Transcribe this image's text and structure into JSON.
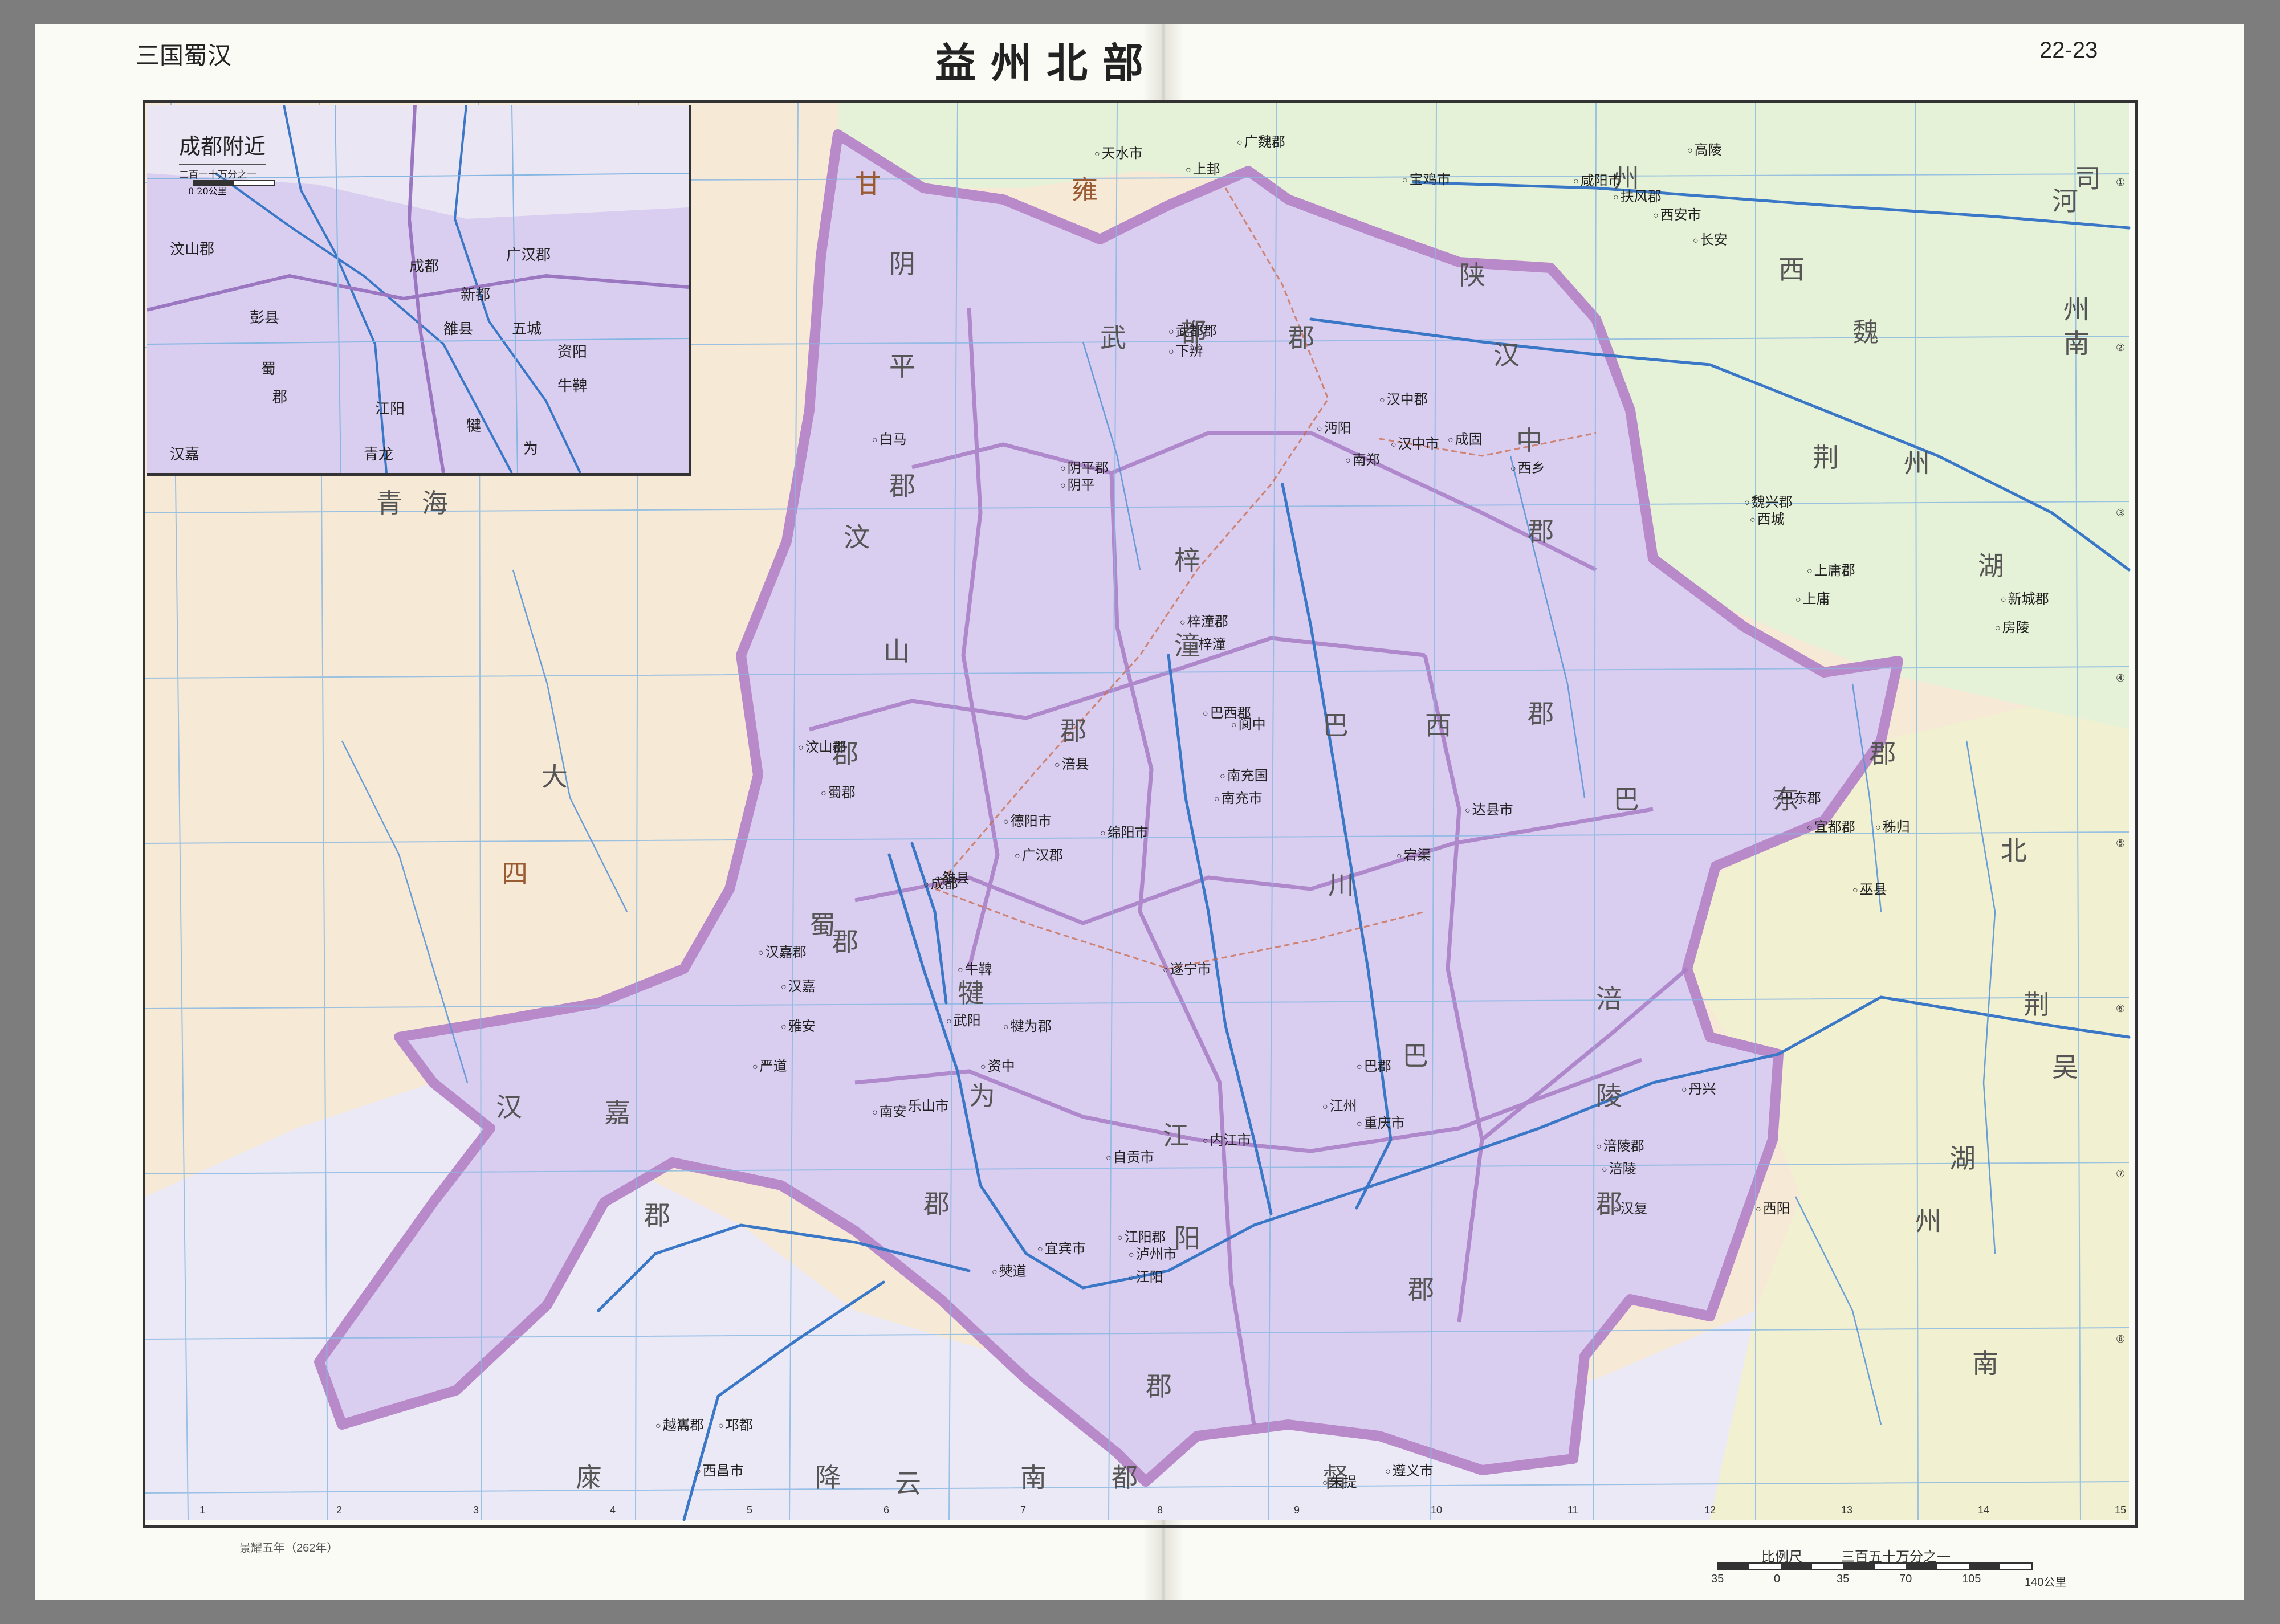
{
  "header": {
    "series_label": "三国蜀汉",
    "map_title": "益州北部",
    "page_numbers": "22-23"
  },
  "inset": {
    "title": "成都附近",
    "scale_text": "二百一十万分之一",
    "scale_ticks": [
      "0",
      "20公里"
    ],
    "labels": [
      "汶山郡",
      "蜀",
      "郡",
      "犍",
      "为",
      "成都",
      "广汉郡",
      "新都",
      "雒县",
      "五城",
      "江阳",
      "牛鞞",
      "资阳",
      "彭县",
      "汉嘉",
      "青龙"
    ]
  },
  "map": {
    "colors": {
      "shu_fill": "#d9cdf0",
      "shu_border": "#b98ac9",
      "wei_fill": "#e6f2d8",
      "qiang_fill": "#f6ead7",
      "south_fill": "#ece9f6",
      "river": "#3a78c7",
      "grid": "#86b7e3",
      "road": "#c96a4a"
    },
    "regions": [
      {
        "text": "甘",
        "style": "brown"
      },
      {
        "text": "阴",
        "style": "plain"
      },
      {
        "text": "平",
        "style": "plain"
      },
      {
        "text": "郡",
        "style": "plain"
      },
      {
        "text": "武",
        "style": "plain"
      },
      {
        "text": "都",
        "style": "plain"
      },
      {
        "text": "郡",
        "style": "plain"
      },
      {
        "text": "汶",
        "style": "plain"
      },
      {
        "text": "山",
        "style": "plain"
      },
      {
        "text": "郡",
        "style": "plain"
      },
      {
        "text": "梓",
        "style": "plain"
      },
      {
        "text": "潼",
        "style": "plain"
      },
      {
        "text": "郡",
        "style": "plain"
      },
      {
        "text": "巴",
        "style": "plain"
      },
      {
        "text": "西",
        "style": "plain"
      },
      {
        "text": "郡",
        "style": "plain"
      },
      {
        "text": "陕",
        "style": "plain"
      },
      {
        "text": "汉",
        "style": "plain"
      },
      {
        "text": "中",
        "style": "plain"
      },
      {
        "text": "郡",
        "style": "plain"
      },
      {
        "text": "巴",
        "style": "plain"
      },
      {
        "text": "东",
        "style": "plain"
      },
      {
        "text": "郡",
        "style": "plain"
      },
      {
        "text": "川",
        "style": "plain"
      },
      {
        "text": "涪",
        "style": "plain"
      },
      {
        "text": "陵",
        "style": "plain"
      },
      {
        "text": "郡",
        "style": "plain"
      },
      {
        "text": "巴",
        "style": "plain"
      },
      {
        "text": "郡",
        "style": "plain"
      },
      {
        "text": "江",
        "style": "plain"
      },
      {
        "text": "阳",
        "style": "plain"
      },
      {
        "text": "郡",
        "style": "plain"
      },
      {
        "text": "犍",
        "style": "plain"
      },
      {
        "text": "为",
        "style": "plain"
      },
      {
        "text": "郡",
        "style": "plain"
      },
      {
        "text": "汉",
        "style": "plain"
      },
      {
        "text": "嘉",
        "style": "plain"
      },
      {
        "text": "郡",
        "style": "plain"
      },
      {
        "text": "蜀",
        "style": "plain"
      },
      {
        "text": "郡",
        "style": "plain"
      },
      {
        "text": "雍",
        "style": "brown"
      },
      {
        "text": "州",
        "style": "plain"
      },
      {
        "text": "西",
        "style": "plain"
      },
      {
        "text": "魏",
        "style": "plain"
      },
      {
        "text": "荆",
        "style": "plain"
      },
      {
        "text": "州",
        "style": "plain"
      },
      {
        "text": "湖",
        "style": "plain"
      },
      {
        "text": "北",
        "style": "plain"
      },
      {
        "text": "荆",
        "style": "plain"
      },
      {
        "text": "吴",
        "style": "plain"
      },
      {
        "text": "湖",
        "style": "plain"
      },
      {
        "text": "州",
        "style": "plain"
      },
      {
        "text": "南",
        "style": "plain"
      },
      {
        "text": "四",
        "style": "brown"
      },
      {
        "text": "大",
        "style": "plain"
      },
      {
        "text": "庲",
        "style": "plain"
      },
      {
        "text": "降",
        "style": "plain"
      },
      {
        "text": "云",
        "style": "plain"
      },
      {
        "text": "南",
        "style": "plain"
      },
      {
        "text": "都",
        "style": "plain"
      },
      {
        "text": "督",
        "style": "plain"
      },
      {
        "text": "青",
        "style": "plain"
      },
      {
        "text": "海",
        "style": "plain"
      },
      {
        "text": "司",
        "style": "plain"
      },
      {
        "text": "河",
        "style": "plain"
      },
      {
        "text": "州",
        "style": "plain"
      },
      {
        "text": "南",
        "style": "plain"
      }
    ],
    "places": [
      "天水市",
      "广魏郡",
      "上邽",
      "宝鸡市",
      "咸阳市",
      "西安市",
      "扶风郡",
      "长安",
      "高陵",
      "汉中郡",
      "汉中市",
      "南郑",
      "沔阳",
      "成固",
      "西乡",
      "武都郡",
      "下辨",
      "阴平郡",
      "阴平",
      "白马",
      "梓潼郡",
      "梓潼",
      "涪县",
      "绵阳市",
      "德阳市",
      "广汉郡",
      "雒县",
      "成都",
      "蜀郡",
      "汶山郡",
      "巴西郡",
      "阆中",
      "南充市",
      "南充国",
      "宕渠",
      "达县市",
      "巴东郡",
      "巴郡",
      "江州",
      "重庆市",
      "涪陵郡",
      "涪陵",
      "江阳郡",
      "江阳",
      "泸州市",
      "犍为郡",
      "武阳",
      "乐山市",
      "南安",
      "宜宾市",
      "僰道",
      "汉嘉郡",
      "汉嘉",
      "雅安",
      "严道",
      "新城郡",
      "房陵",
      "魏兴郡",
      "西城",
      "上庸郡",
      "上庸",
      "宜都郡",
      "巫县",
      "秭归",
      "西阳",
      "汉复",
      "丹兴",
      "越巂郡",
      "邛都",
      "西昌市",
      "遵义市",
      "朱提",
      "自贡市",
      "内江市",
      "遂宁市",
      "资中",
      "牛鞞"
    ],
    "lat_ticks": [
      "①",
      "②",
      "③",
      "④",
      "⑤",
      "⑥",
      "⑦",
      "⑧"
    ],
    "lon_ticks": [
      "1",
      "2",
      "3",
      "4",
      "5",
      "6",
      "7",
      "8",
      "9",
      "10",
      "11",
      "12",
      "13",
      "14",
      "15"
    ]
  },
  "footer": {
    "era_note": "景耀五年（262年）",
    "scale_label": "比例尺",
    "scale_ratio": "三百五十万分之一",
    "scale_ticks": [
      "35",
      "0",
      "35",
      "70",
      "105",
      "140公里"
    ]
  }
}
